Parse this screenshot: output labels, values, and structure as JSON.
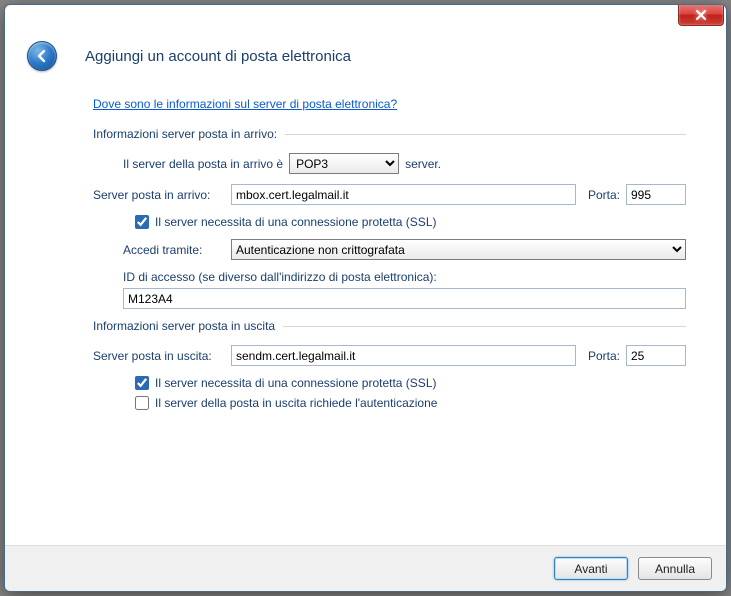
{
  "header": {
    "title": "Aggiungi un account di posta elettronica"
  },
  "help_link": "Dove sono le informazioni sul server di posta elettronica?",
  "incoming": {
    "section_label": "Informazioni server posta in arrivo:",
    "server_type_prefix": "Il server della posta in arrivo è",
    "server_type_value": "POP3",
    "server_type_suffix": "server.",
    "server_label": "Server posta in arrivo:",
    "server_value": "mbox.cert.legalmail.it",
    "port_label": "Porta:",
    "port_value": "995",
    "ssl_label": "Il server necessita di una connessione protetta (SSL)",
    "auth_label": "Accedi tramite:",
    "auth_value": "Autenticazione non crittografata",
    "login_id_label": "ID di accesso (se diverso dall'indirizzo di posta elettronica):",
    "login_id_value": "M123A4"
  },
  "outgoing": {
    "section_label": "Informazioni server posta in uscita",
    "server_label": "Server posta in uscita:",
    "server_value": "sendm.cert.legalmail.it",
    "port_label": "Porta:",
    "port_value": "25",
    "ssl_label": "Il server necessita di una connessione protetta (SSL)",
    "auth_required_label": "Il server della posta in uscita richiede l'autenticazione"
  },
  "footer": {
    "next": "Avanti",
    "cancel": "Annulla"
  }
}
